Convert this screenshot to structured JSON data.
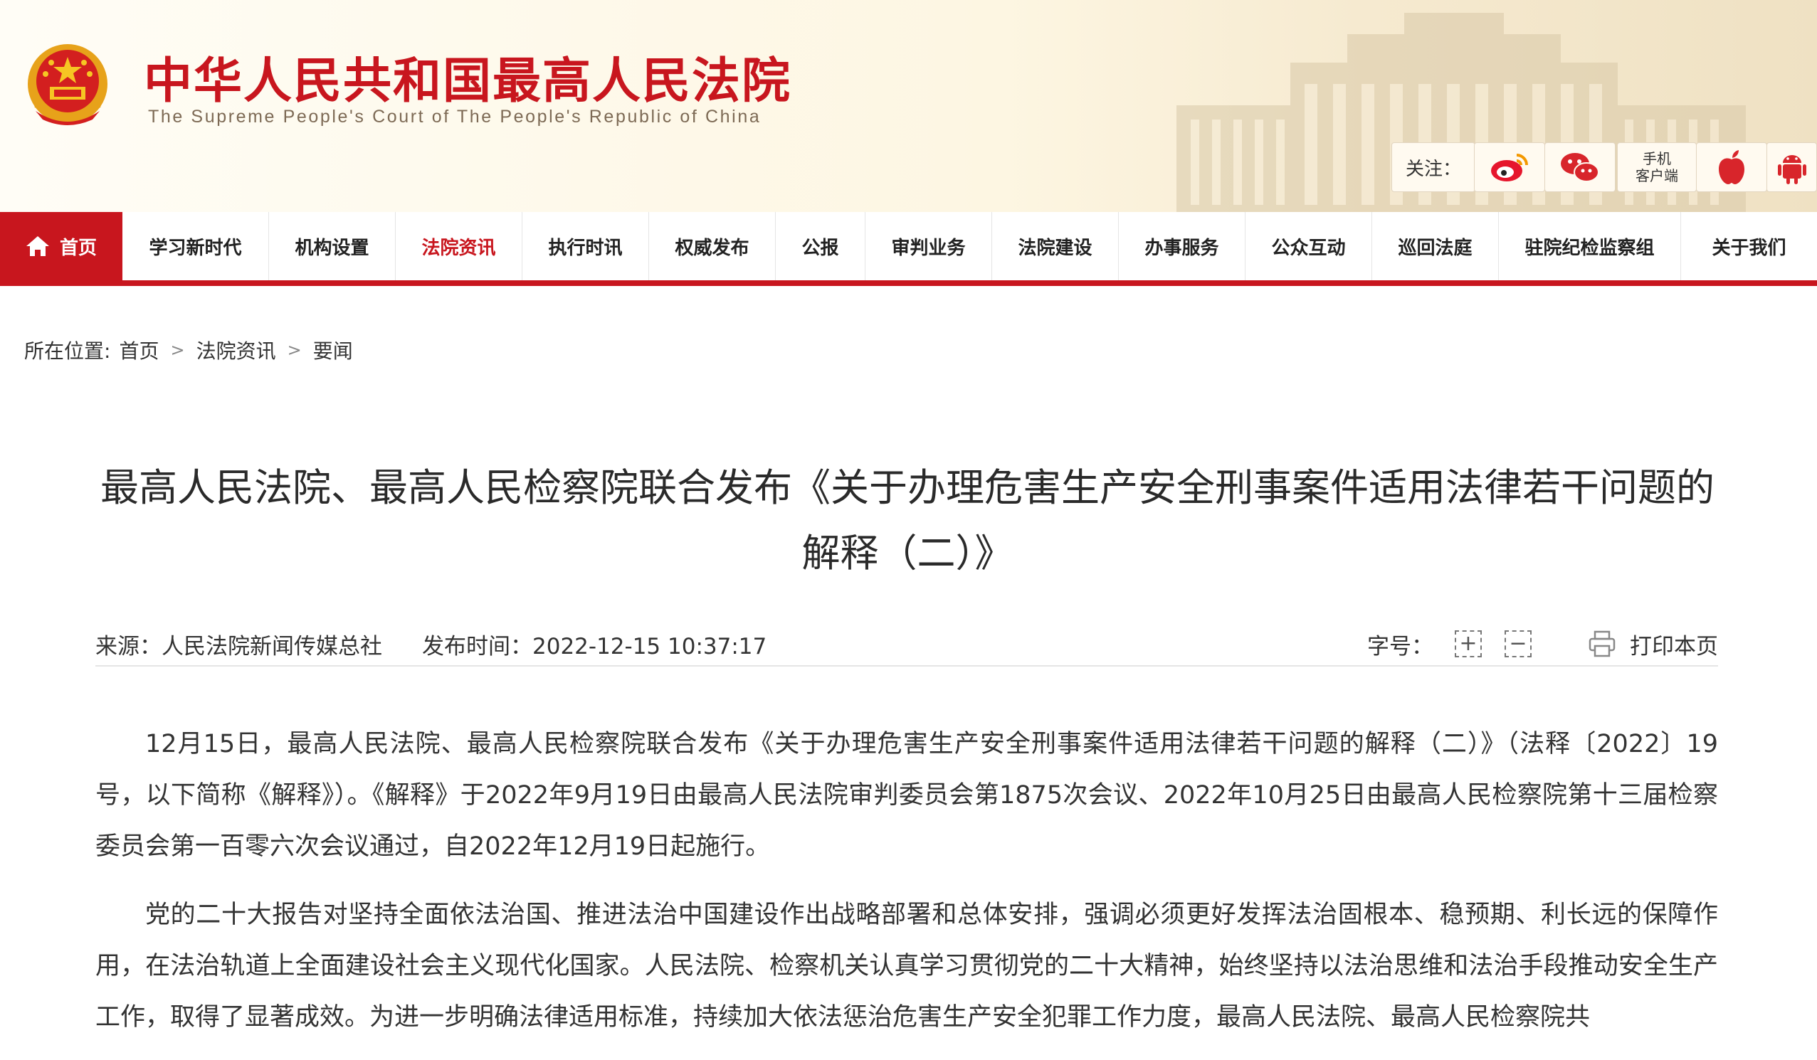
{
  "header": {
    "title": "中华人民共和国最高人民法院",
    "subtitle": "The Supreme People's Court of The People's Republic of China",
    "follow_label": "关注：",
    "app_label_line1": "手机",
    "app_label_line2": "客户端",
    "icons": [
      "weibo-icon",
      "wechat-icon",
      "apple-icon",
      "android-icon"
    ]
  },
  "nav": {
    "items": [
      "首页",
      "学习新时代",
      "机构设置",
      "法院资讯",
      "执行时讯",
      "权威发布",
      "公报",
      "审判业务",
      "法院建设",
      "办事服务",
      "公众互动",
      "巡回法庭",
      "驻院纪检监察组",
      "关于我们"
    ],
    "active_index": 3
  },
  "breadcrumb": {
    "label": "所在位置:",
    "items": [
      "首页",
      "法院资讯",
      "要闻"
    ]
  },
  "article": {
    "title": "最高人民法院、最高人民检察院联合发布《关于办理危害生产安全刑事案件适用法律若干问题的解释（二）》",
    "source": "来源：人民法院新闻传媒总社",
    "publish_time": "发布时间：2022-12-15 10:37:17",
    "font_size_label": "字号：",
    "font_increase": "+",
    "font_decrease": "−",
    "print_label": "打印本页",
    "paragraphs": [
      "12月15日，最高人民法院、最高人民检察院联合发布《关于办理危害生产安全刑事案件适用法律若干问题的解释（二）》（法释〔2022〕19号，以下简称《解释》）。《解释》于2022年9月19日由最高人民法院审判委员会第1875次会议、2022年10月25日由最高人民检察院第十三届检察委员会第一百零六次会议通过，自2022年12月19日起施行。",
      "党的二十大报告对坚持全面依法治国、推进法治中国建设作出战略部署和总体安排，强调必须更好发挥法治固根本、稳预期、利长远的保障作用，在法治轨道上全面建设社会主义现代化国家。人民法院、检察机关认真学习贯彻党的二十大精神，始终坚持以法治思维和法治手段推动安全生产工作，取得了显著成效。为进一步明确法律适用标准，持续加大依法惩治危害生产安全犯罪工作力度，最高人民法院、最高人民检察院共"
    ]
  },
  "colors": {
    "brand_red": "#c8161e",
    "header_bg": "#fdf6e2",
    "text": "#333333"
  }
}
